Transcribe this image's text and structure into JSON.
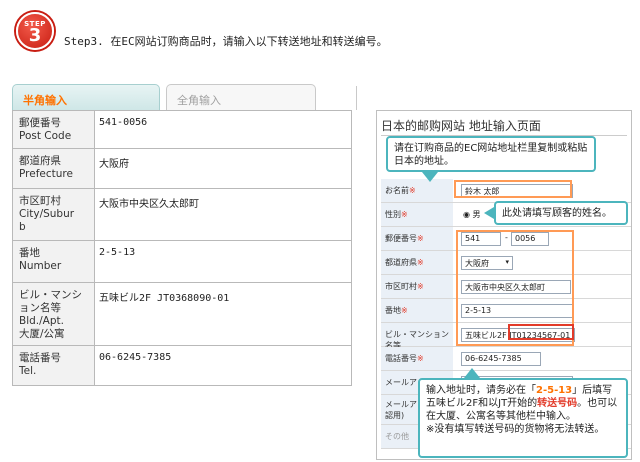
{
  "header": {
    "step_badge_label": "STEP",
    "step_badge_number": "3",
    "title": "Step3. 在EC网站订购商品时，请输入以下转送地址和转送编号。"
  },
  "tabs": [
    {
      "label": "半角输入",
      "active": true
    },
    {
      "label": "全角输入",
      "active": false
    }
  ],
  "address_rows": [
    {
      "key": "郵便番号\nPost Code",
      "value": "541-0056"
    },
    {
      "key": "都道府県\nPrefecture",
      "value": "大阪府"
    },
    {
      "key": "市区町村\nCity/Subur\nb",
      "value": "大阪市中央区久太郎町"
    },
    {
      "key": "番地\nNumber",
      "value": "2-5-13"
    },
    {
      "key": "ビル・マンシ\nョン名等\nBld./Apt.\n大厦/公寓",
      "value": "五味ビル2F JT0368090-01"
    },
    {
      "key": "電話番号\nTel.",
      "value": "06-6245-7385"
    }
  ],
  "right_panel": {
    "title": "日本的邮购网站 地址输入页面",
    "form": {
      "name_label": "お名前",
      "name_value": "鈴木 太郎",
      "gender_label": "性別",
      "gender_value": "男",
      "postcode_label": "郵便番号",
      "postcode_1": "541",
      "postcode_2": "0056",
      "pref_label": "都道府県",
      "pref_value": "大阪府",
      "city_label": "市区町村",
      "city_value": "大阪市中央区久太郎町",
      "banchi_label": "番地",
      "banchi_value": "2-5-13",
      "bld_label": "ビル・マンション名等",
      "bld_value_prefix": "五味ビル2F",
      "bld_value_code": "JT01234567-01",
      "tel_label": "電話番号",
      "tel_value": "06-6245-7385",
      "mail_label": "メールアドレス",
      "mail_confirm_label": "メールアドレス(確認用)",
      "other_label": "その他"
    }
  },
  "callouts": {
    "top": "请在订购商品的EC网站地址栏里复制或粘贴日本的地址。",
    "name": "此处请填写顾客的姓名。",
    "bottom_1": "输入地址时，请务必在「",
    "bottom_1_hl": "2-5-13",
    "bottom_1_end": "」后填写五味ビル2F和以JT开始的",
    "bottom_1_hl2": "转送号码",
    "bottom_2": "。也可以在大厦、公寓名等其他栏中输入。",
    "bottom_3": "※没有填写转送号码的货物将无法转送。"
  }
}
